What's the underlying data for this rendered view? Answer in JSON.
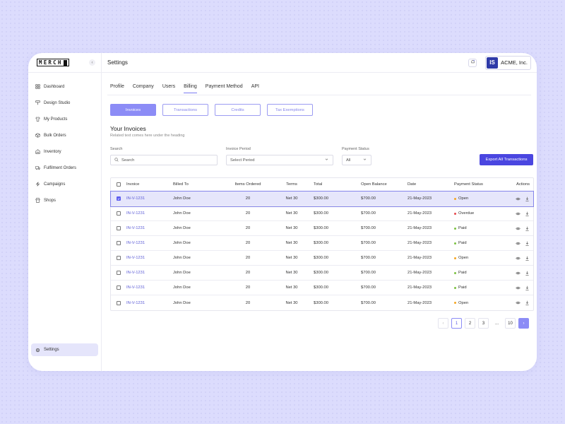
{
  "brand": {
    "logo_text": "MERCH"
  },
  "sidebar": {
    "items": [
      {
        "label": "Dashboard",
        "icon": "grid-icon"
      },
      {
        "label": "Design Studio",
        "icon": "brush-icon"
      },
      {
        "label": "My Products",
        "icon": "shirt-icon"
      },
      {
        "label": "Bulk Orders",
        "icon": "box-icon"
      },
      {
        "label": "Inventory",
        "icon": "warehouse-icon"
      },
      {
        "label": "Fulfilment Orders",
        "icon": "truck-icon"
      },
      {
        "label": "Campaigns",
        "icon": "bolt-icon"
      },
      {
        "label": "Shops",
        "icon": "store-icon"
      }
    ],
    "settings_label": "Settings"
  },
  "header": {
    "title": "Settings",
    "avatar_initials": "IS",
    "company_name": "ACME, Inc."
  },
  "tabs": [
    "Profile",
    "Company",
    "Users",
    "Billing",
    "Payment Method",
    "API"
  ],
  "active_tab": "Billing",
  "subtabs": [
    "Invoices",
    "Transactions",
    "Credits",
    "Tax Exemptions"
  ],
  "active_subtab": "Invoices",
  "section": {
    "title": "Your Invoices",
    "subtitle": "Related text comes here under the heading"
  },
  "filters": {
    "search_label": "Search",
    "search_placeholder": "Search",
    "period_label": "Invoice Period",
    "period_value": "Select Period",
    "status_label": "Payment Status",
    "status_value": "All",
    "export_label": "Export All Transactions"
  },
  "table": {
    "columns": [
      "Invoice",
      "Billed To",
      "Items Ordered",
      "Terms",
      "Total",
      "Open Balance",
      "Date",
      "Payment Status",
      "Actions"
    ],
    "rows": [
      {
        "invoice": "IN-V-1231",
        "billed_to": "John Doe",
        "items": "20",
        "terms": "Net 30",
        "total": "$300.00",
        "open": "$700.00",
        "date": "21-May-2023",
        "status": "Open",
        "selected": true
      },
      {
        "invoice": "IN-V-1231",
        "billed_to": "John Doe",
        "items": "20",
        "terms": "Net 30",
        "total": "$300.00",
        "open": "$700.00",
        "date": "21-May-2023",
        "status": "Overdue",
        "selected": false
      },
      {
        "invoice": "IN-V-1231",
        "billed_to": "John Doe",
        "items": "20",
        "terms": "Net 30",
        "total": "$300.00",
        "open": "$700.00",
        "date": "21-May-2023",
        "status": "Paid",
        "selected": false
      },
      {
        "invoice": "IN-V-1231",
        "billed_to": "John Doe",
        "items": "20",
        "terms": "Net 30",
        "total": "$300.00",
        "open": "$700.00",
        "date": "21-May-2023",
        "status": "Paid",
        "selected": false
      },
      {
        "invoice": "IN-V-1231",
        "billed_to": "John Doe",
        "items": "20",
        "terms": "Net 30",
        "total": "$300.00",
        "open": "$700.00",
        "date": "21-May-2023",
        "status": "Open",
        "selected": false
      },
      {
        "invoice": "IN-V-1231",
        "billed_to": "John Doe",
        "items": "20",
        "terms": "Net 30",
        "total": "$300.00",
        "open": "$700.00",
        "date": "21-May-2023",
        "status": "Paid",
        "selected": false
      },
      {
        "invoice": "IN-V-1231",
        "billed_to": "John Doe",
        "items": "20",
        "terms": "Net 30",
        "total": "$300.00",
        "open": "$700.00",
        "date": "21-May-2023",
        "status": "Paid",
        "selected": false
      },
      {
        "invoice": "IN-V-1231",
        "billed_to": "John Doe",
        "items": "20",
        "terms": "Net 30",
        "total": "$300.00",
        "open": "$700.00",
        "date": "21-May-2023",
        "status": "Open",
        "selected": false
      }
    ]
  },
  "status_colors": {
    "Open": "#f5a623",
    "Overdue": "#e5484d",
    "Paid": "#7cc243"
  },
  "pagination": {
    "pages": [
      "1",
      "2",
      "3",
      "...",
      "10"
    ],
    "current": "1"
  },
  "colors": {
    "accent": "#4a46e0",
    "accent_light": "#8c8cf6",
    "background": "#dcdcfd"
  }
}
